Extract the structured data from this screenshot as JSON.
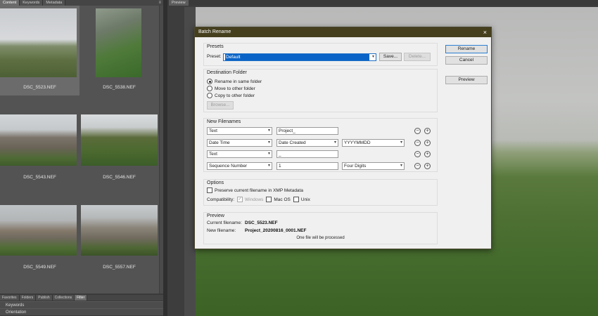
{
  "left_panel": {
    "tabs": [
      "Content",
      "Keywords",
      "Metadata"
    ],
    "thumbnails": [
      {
        "name": "DSC_5523.NEF",
        "selected": true
      },
      {
        "name": "DSC_5538.NEF",
        "selected": false
      },
      {
        "name": "DSC_5543.NEF",
        "selected": false
      },
      {
        "name": "DSC_5546.NEF",
        "selected": false
      },
      {
        "name": "DSC_5549.NEF",
        "selected": false
      },
      {
        "name": "DSC_5557.NEF",
        "selected": false
      }
    ],
    "bottom_tabs": [
      "Favorites",
      "Folders",
      "Publish",
      "Collections",
      "Filter"
    ],
    "filter_rows": [
      "Keywords",
      "Orientation"
    ]
  },
  "preview_panel": {
    "tab": "Preview"
  },
  "dialog": {
    "title": "Batch Rename",
    "close": "×",
    "presets": {
      "group_title": "Presets",
      "label": "Preset:",
      "value": "Default",
      "save_button": "Save...",
      "delete_button": "Delete..."
    },
    "destination": {
      "group_title": "Destination Folder",
      "options": [
        "Rename in same folder",
        "Move to other folder",
        "Copy to other folder"
      ],
      "selected_index": 0,
      "browse_button": "Browse..."
    },
    "new_filenames": {
      "group_title": "New Filenames",
      "rows": [
        {
          "type": "Text",
          "value": "Project_",
          "format": ""
        },
        {
          "type": "Date Time",
          "value": "Date Created",
          "format": "YYYYMMDD"
        },
        {
          "type": "Text",
          "value": "_",
          "format": ""
        },
        {
          "type": "Sequence Number",
          "value": "1",
          "format": "Four Digits"
        }
      ],
      "minus": "−",
      "plus": "+"
    },
    "options": {
      "group_title": "Options",
      "preserve_label": "Preserve current filename in XMP Metadata",
      "compat_label": "Compatibility:",
      "windows": "Windows",
      "macos": "Mac OS",
      "unix": "Unix"
    },
    "preview": {
      "group_title": "Preview",
      "current_label": "Current filename:",
      "current_value": "DSC_5523.NEF",
      "new_label": "New filename:",
      "new_value": "Project_20200816_0001.NEF",
      "status": "One file will be processed"
    },
    "buttons": {
      "rename": "Rename",
      "cancel": "Cancel",
      "preview": "Preview"
    }
  }
}
